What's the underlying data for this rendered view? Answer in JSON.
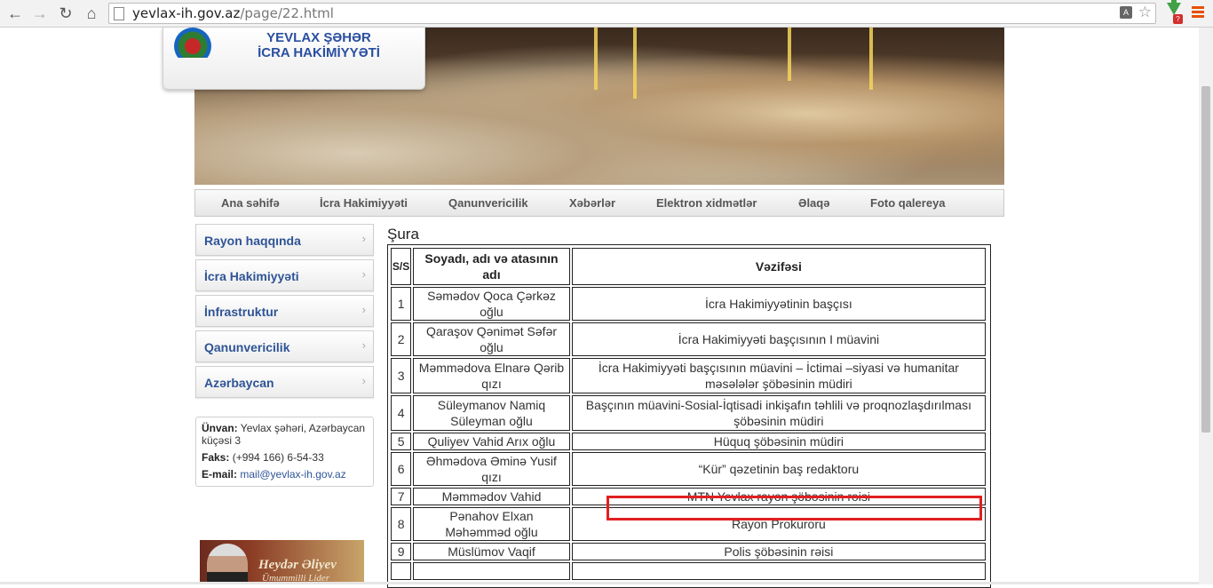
{
  "browser": {
    "url_host": "yevlax-ih.gov.az",
    "url_path": "/page/22.html",
    "icons": [
      "back-icon",
      "forward-icon",
      "reload-icon",
      "home-icon",
      "page-icon",
      "translate-icon",
      "star-icon",
      "download-extension-icon",
      "menu-icon"
    ]
  },
  "header": {
    "title_line1": "YEVLAX ŞƏHƏR",
    "title_line2": "İCRA HAKİMİYYƏTİ"
  },
  "main_nav": [
    "Ana səhifə",
    "İcra Hakimiyyəti",
    "Qanunvericilik",
    "Xəbərlər",
    "Elektron xidmətlər",
    "Əlaqə",
    "Foto qalereya"
  ],
  "sidebar": {
    "items": [
      "Rayon haqqında",
      "İcra Hakimiyyəti",
      "İnfrastruktur",
      "Qanunvericilik",
      "Azərbaycan"
    ],
    "contact": {
      "address_label": "Ünvan:",
      "address_value": "Yevlax şəhəri, Azərbaycan",
      "address_value2": "küçəsi 3",
      "fax_label": "Faks:",
      "fax_value": "(+994 166) 6-54-33",
      "email_label": "E-mail:",
      "email_value": "mail@yevlax-ih.gov.az"
    },
    "banner": {
      "name": "Heydər Əliyev",
      "subtitle": "Ümummilli Lider"
    }
  },
  "content": {
    "title": "Şura",
    "table": {
      "headers": [
        "S/S",
        "Soyadı, adı və atasının adı",
        "Vəzifəsi"
      ],
      "rows": [
        {
          "n": "1",
          "name": "Səmədov Qoca Çərkəz oğlu",
          "position": "İcra Hakimiyyətinin başçısı"
        },
        {
          "n": "2",
          "name": "Qaraşov Qənimət Səfər oğlu",
          "position": "İcra Hakimiyyəti başçısının I müavini"
        },
        {
          "n": "3",
          "name": "Məmmədova Elnarə Qərib qızı",
          "position": "İcra Hakimiyyəti başçısının müavini – İctimai –siyasi və humanitar məsələlər şöbəsinin müdiri"
        },
        {
          "n": "4",
          "name": "Süleymanov Namiq Süleyman oğlu",
          "position": "Başçının müavini-Sosial-İqtisadi inkişafın təhlili və proqnozlaşdırılması şöbəsinin müdiri"
        },
        {
          "n": "5",
          "name": "Quliyev Vahid Arıx oğlu",
          "position": "Hüquq şöbəsinin müdiri"
        },
        {
          "n": "6",
          "name": "Əhmədova Əminə Yusif qızı",
          "position": "“Kür” qəzetinin baş redaktoru"
        },
        {
          "n": "7",
          "name": "Məmmədov Vahid",
          "position": "MTN Yevlax rayon şöbəsinin rəisi"
        },
        {
          "n": "8",
          "name": "Pənahov Elxan Məhəmməd oğlu",
          "position": "Rayon Prokuroru"
        },
        {
          "n": "9",
          "name": "Müslümov Vaqif",
          "position": "Polis şöbəsinin rəisi"
        },
        {
          "n": "",
          "name": "",
          "position": ""
        }
      ]
    }
  }
}
